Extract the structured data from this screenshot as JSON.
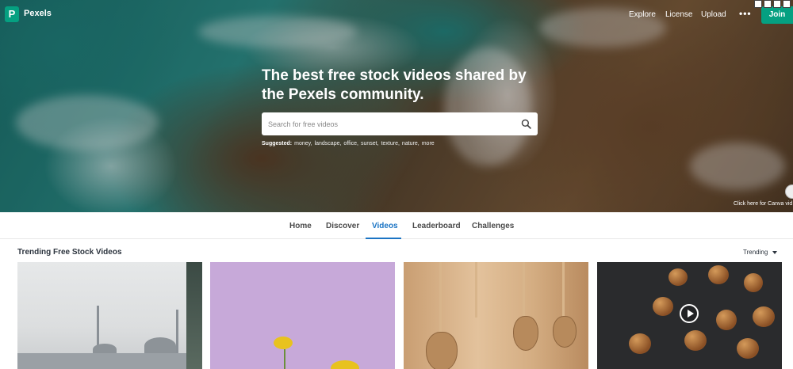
{
  "header": {
    "logo_letter": "P",
    "brand": "Pexels",
    "nav": [
      "Explore",
      "License",
      "Upload"
    ],
    "more": "•••",
    "join": "Join"
  },
  "hero": {
    "headline": "The best free stock videos shared by the Pexels community.",
    "search_placeholder": "Search for free videos",
    "suggested_label": "Suggested:",
    "suggested": [
      "money,",
      "landscape,",
      "office,",
      "sunset,",
      "texture,",
      "nature,",
      "more"
    ],
    "canva_text": "Click here for Canva vid"
  },
  "tabs": [
    {
      "label": "Home",
      "active": false
    },
    {
      "label": "Discover",
      "active": false
    },
    {
      "label": "Videos",
      "active": true
    },
    {
      "label": "Leaderboard",
      "active": false
    },
    {
      "label": "Challenges",
      "active": false
    }
  ],
  "trending": {
    "title": "Trending Free Stock Videos",
    "sort": "Trending"
  },
  "colors": {
    "brand": "#05a081",
    "active_tab": "#1b74c4"
  }
}
